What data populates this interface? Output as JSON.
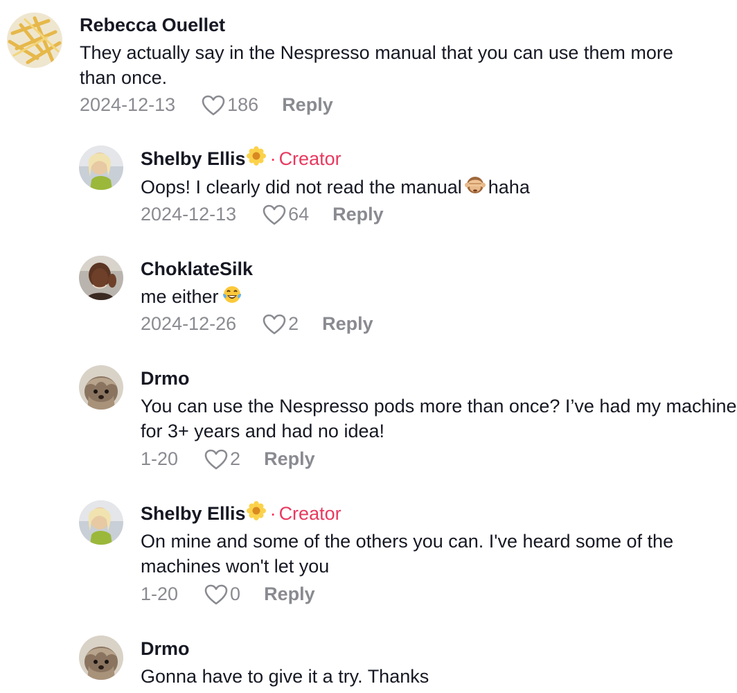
{
  "comments": [
    {
      "user": "Rebecca Ouellet",
      "is_creator": false,
      "text": "They actually say in the Nespresso manual that you can use them more than once.",
      "date": "2024-12-13",
      "likes": "186",
      "reply_label": "Reply",
      "avatar": "fries-avatar"
    },
    {
      "user": "Shelby Ellis",
      "is_creator": true,
      "creator_label": "Creator",
      "separator": "·",
      "text_before": "Oops! I clearly did not read the manual",
      "emoji": "see-no-evil-monkey",
      "text_after": "haha",
      "date": "2024-12-13",
      "likes": "64",
      "reply_label": "Reply"
    },
    {
      "user": "ChoklateSilk",
      "is_creator": false,
      "text_before": "me either",
      "emoji": "tears-of-joy",
      "date": "2024-12-26",
      "likes": "2",
      "reply_label": "Reply"
    },
    {
      "user": "Drmo",
      "is_creator": false,
      "text": "You can use the Nespresso pods more than once? I’ve had my machine for 3+ years and had no idea!",
      "date": "1-20",
      "likes": "2",
      "reply_label": "Reply"
    },
    {
      "user": "Shelby Ellis",
      "is_creator": true,
      "creator_label": "Creator",
      "separator": "·",
      "text": "On mine and some of the others you can. I've heard some of the machines won't let you",
      "date": "1-20",
      "likes": "0",
      "reply_label": "Reply"
    },
    {
      "user": "Drmo",
      "is_creator": false,
      "text": "Gonna have to give it a try. Thanks"
    }
  ],
  "colors": {
    "creator": "#e8395f",
    "meta": "#8a8b91",
    "text": "#161823"
  }
}
